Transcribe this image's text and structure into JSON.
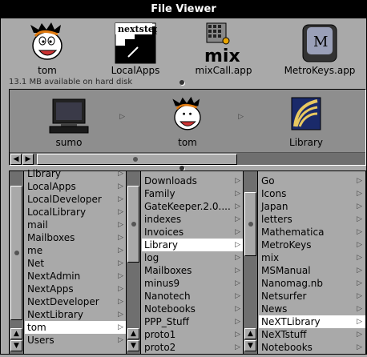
{
  "window": {
    "title": "File Viewer"
  },
  "shelf": [
    {
      "label": "tom",
      "icon": "calvin-face-icon"
    },
    {
      "label": "LocalApps",
      "icon": "nextstep-logo-icon"
    },
    {
      "label": "mixCall.app",
      "icon": "mix-app-icon"
    },
    {
      "label": "MetroKeys.app",
      "icon": "metrokeys-key-icon"
    }
  ],
  "disk_status": "13.1 MB available on hard disk",
  "path_browser": [
    {
      "label": "sumo",
      "icon": "computer-icon"
    },
    {
      "label": "tom",
      "icon": "calvin-face-icon"
    },
    {
      "label": "Library",
      "icon": "library-book-icon"
    }
  ],
  "columns": [
    {
      "items": [
        "Library",
        "LocalApps",
        "LocalDeveloper",
        "LocalLibrary",
        "mail",
        "Mailboxes",
        "me",
        "Net",
        "NextAdmin",
        "NextApps",
        "NextDeveloper",
        "NextLibrary",
        "tom",
        "Users"
      ],
      "selected": "tom"
    },
    {
      "items": [
        "Downloads",
        "Family",
        "GateKeeper.2.0....",
        "indexes",
        "Invoices",
        "Library",
        "log",
        "Mailboxes",
        "minus9",
        "Nanotech",
        "Notebooks",
        "PPP_Stuff",
        "proto1",
        "proto2"
      ],
      "selected": "Library"
    },
    {
      "items": [
        "Go",
        "Icons",
        "Japan",
        "letters",
        "Mathematica",
        "MetroKeys",
        "mix",
        "MSManual",
        "Nanomag.nb",
        "Netsurfer",
        "News",
        "NeXTLibrary",
        "NeXTstuff",
        "Notebooks"
      ],
      "selected": "NeXTLibrary"
    }
  ]
}
